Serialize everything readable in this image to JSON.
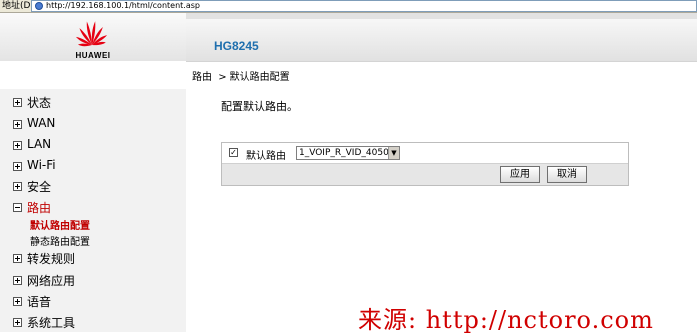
{
  "address_bar": {
    "label": "地址(D)",
    "url": "http://192.168.100.1/html/content.asp"
  },
  "brand": {
    "logo_text": "HUAWEI",
    "product_name": "HG8245"
  },
  "breadcrumb": {
    "section": "路由",
    "separator": ">",
    "page": "默认路由配置"
  },
  "description": "配置默认路由。",
  "nav": {
    "items": [
      {
        "label": "状态",
        "expanded": false
      },
      {
        "label": "WAN",
        "expanded": false
      },
      {
        "label": "LAN",
        "expanded": false
      },
      {
        "label": "Wi-Fi",
        "expanded": false
      },
      {
        "label": "安全",
        "expanded": false
      },
      {
        "label": "路由",
        "expanded": true
      },
      {
        "label": "转发规则",
        "expanded": false
      },
      {
        "label": "网络应用",
        "expanded": false
      },
      {
        "label": "语音",
        "expanded": false
      },
      {
        "label": "系统工具",
        "expanded": false
      }
    ],
    "sub_items": [
      {
        "label": "默认路由配置",
        "current": true
      },
      {
        "label": "静态路由配置",
        "current": false
      }
    ]
  },
  "form": {
    "default_route_label": "默认路由",
    "default_route_checked": true,
    "wan_select_value": "1_VOIP_R_VID_4050",
    "apply_label": "应用",
    "cancel_label": "取消"
  },
  "watermark": "来源: http://nctoro.com",
  "colors": {
    "brand_red": "#e60012",
    "product_blue": "#1f6fae",
    "active_red": "#c00000"
  }
}
